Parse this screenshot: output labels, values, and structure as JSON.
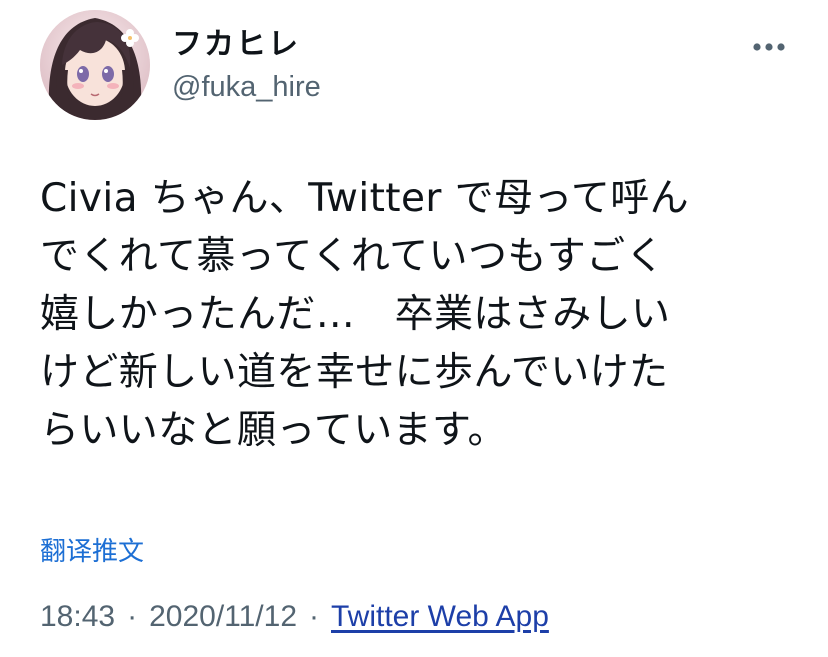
{
  "user": {
    "display_name": "フカヒレ",
    "handle": "@fuka_hire"
  },
  "icons": {
    "more": "more-horizontal-icon",
    "avatar": "avatar-anime-girl"
  },
  "tweet": {
    "lines": [
      "Civia ちゃん、Twitter で母って呼ん",
      "でくれて慕ってくれていつもすごく",
      "嬉しかったんだ…　卒業はさみしい",
      "けど新しい道を幸せに歩んでいけた",
      "らいいなと願っています。"
    ]
  },
  "translate_label": "翻译推文",
  "meta": {
    "time": "18:43",
    "separator": "·",
    "date": "2020/11/12",
    "source": "Twitter Web App"
  },
  "colors": {
    "link_blue": "#1d6fd4",
    "source_blue": "#1d3fa8",
    "secondary_gray": "#536471"
  }
}
